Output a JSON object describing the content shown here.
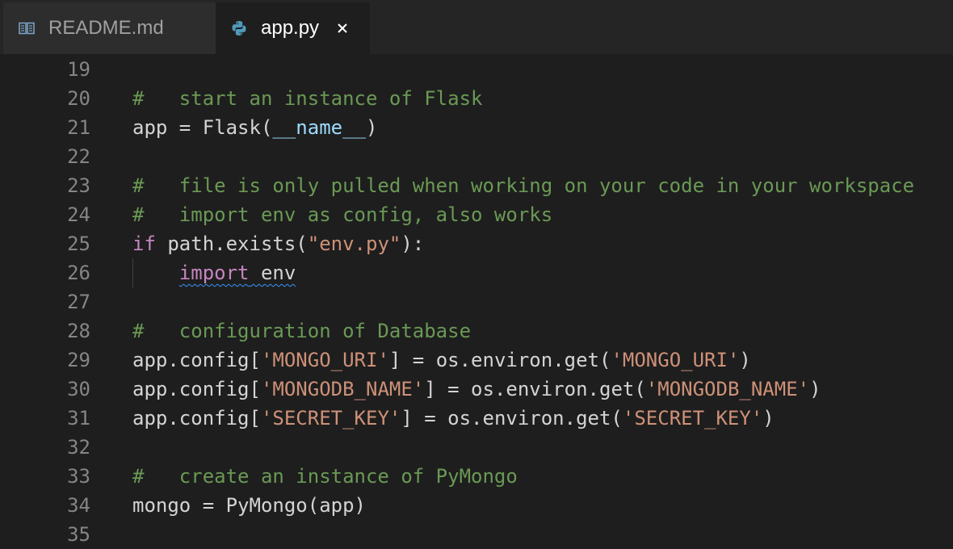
{
  "tabs": [
    {
      "label": "README.md",
      "icon": "book-icon",
      "active": false
    },
    {
      "label": "app.py",
      "icon": "python-icon",
      "active": true,
      "close": "×"
    }
  ],
  "colors": {
    "comment": "#6a9955",
    "keyword": "#c586c0",
    "string": "#ce9178",
    "variable": "#9cdcfe",
    "text": "#d4d4d4",
    "line_number": "#858585",
    "background": "#1e1e1e"
  },
  "lines": [
    {
      "num": "19",
      "tokens": []
    },
    {
      "num": "20",
      "tokens": [
        {
          "t": "#   start an instance of Flask",
          "k": "comment"
        }
      ]
    },
    {
      "num": "21",
      "tokens": [
        {
          "t": "app = Flask(",
          "k": "plain"
        },
        {
          "t": "__name__",
          "k": "var"
        },
        {
          "t": ")",
          "k": "plain"
        }
      ]
    },
    {
      "num": "22",
      "tokens": []
    },
    {
      "num": "23",
      "tokens": [
        {
          "t": "#   file is only pulled when working on your code in your workspace",
          "k": "comment"
        }
      ]
    },
    {
      "num": "24",
      "tokens": [
        {
          "t": "#   import env as config, also works",
          "k": "comment"
        }
      ]
    },
    {
      "num": "25",
      "tokens": [
        {
          "t": "if",
          "k": "keyword"
        },
        {
          "t": " path.exists(",
          "k": "plain"
        },
        {
          "t": "\"env.py\"",
          "k": "string"
        },
        {
          "t": "):",
          "k": "plain"
        }
      ]
    },
    {
      "num": "26",
      "guide": true,
      "tokens": [
        {
          "t": "    ",
          "k": "plain"
        },
        {
          "t": "import",
          "k": "keyword",
          "squiggle": true
        },
        {
          "t": " env",
          "k": "plain",
          "squiggle": true
        }
      ]
    },
    {
      "num": "27",
      "tokens": []
    },
    {
      "num": "28",
      "tokens": [
        {
          "t": "#   configuration of Database",
          "k": "comment"
        }
      ]
    },
    {
      "num": "29",
      "tokens": [
        {
          "t": "app.config[",
          "k": "plain"
        },
        {
          "t": "'MONGO_URI'",
          "k": "string"
        },
        {
          "t": "] = os.environ.get(",
          "k": "plain"
        },
        {
          "t": "'MONGO_URI'",
          "k": "string"
        },
        {
          "t": ")",
          "k": "plain"
        }
      ]
    },
    {
      "num": "30",
      "tokens": [
        {
          "t": "app.config[",
          "k": "plain"
        },
        {
          "t": "'MONGODB_NAME'",
          "k": "string"
        },
        {
          "t": "] = os.environ.get(",
          "k": "plain"
        },
        {
          "t": "'MONGODB_NAME'",
          "k": "string"
        },
        {
          "t": ")",
          "k": "plain"
        }
      ]
    },
    {
      "num": "31",
      "tokens": [
        {
          "t": "app.config[",
          "k": "plain"
        },
        {
          "t": "'SECRET_KEY'",
          "k": "string"
        },
        {
          "t": "] = os.environ.get(",
          "k": "plain"
        },
        {
          "t": "'SECRET_KEY'",
          "k": "string"
        },
        {
          "t": ")",
          "k": "plain"
        }
      ]
    },
    {
      "num": "32",
      "tokens": []
    },
    {
      "num": "33",
      "tokens": [
        {
          "t": "#   create an instance of PyMongo",
          "k": "comment"
        }
      ]
    },
    {
      "num": "34",
      "tokens": [
        {
          "t": "mongo = PyMongo(app)",
          "k": "plain"
        }
      ]
    },
    {
      "num": "35",
      "tokens": []
    }
  ]
}
